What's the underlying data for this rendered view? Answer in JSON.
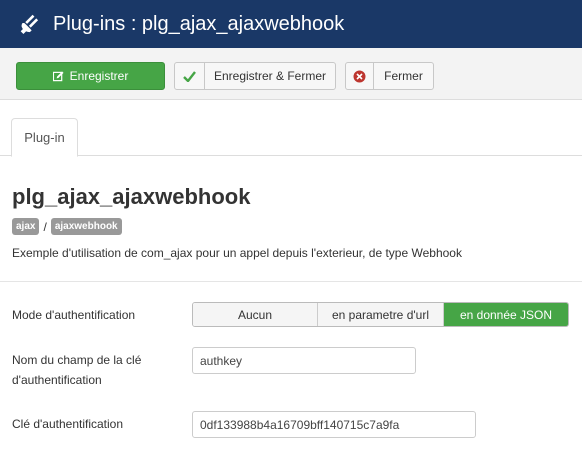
{
  "header": {
    "title": "Plug-ins : plg_ajax_ajaxwebhook",
    "icon": "plug-icon"
  },
  "toolbar": {
    "save_label": "Enregistrer",
    "save_close_label": "Enregistrer & Fermer",
    "close_label": "Fermer"
  },
  "tabs": [
    {
      "label": "Plug-in",
      "active": true
    }
  ],
  "plugin": {
    "name": "plg_ajax_ajaxwebhook",
    "badge_group": "ajax",
    "badge_separator": "/",
    "badge_element": "ajaxwebhook",
    "description": "Exemple d'utilisation de com_ajax pour un appel depuis l'exterieur, de type Webhook"
  },
  "fields": {
    "auth_mode": {
      "label": "Mode d'authentification",
      "options": [
        "Aucun",
        "en parametre d'url",
        "en donnée JSON"
      ],
      "selected": "en donnée JSON"
    },
    "key_field_name": {
      "label": "Nom du champ de la clé d'authentification",
      "value": "authkey"
    },
    "auth_key": {
      "label": "Clé d'authentification",
      "value": "0df133988b4a16709bff140715c7a9fa"
    }
  },
  "colors": {
    "header": "#1a3867",
    "success": "#46a546",
    "danger": "#bd362f"
  }
}
